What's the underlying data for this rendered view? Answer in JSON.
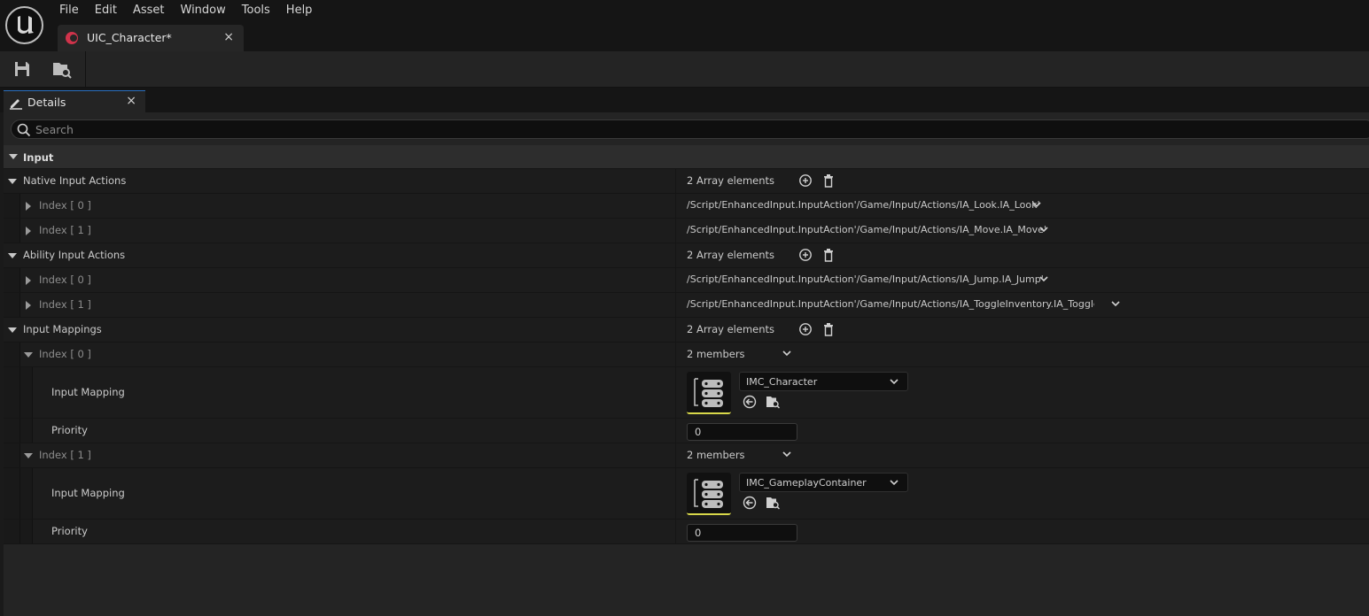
{
  "menu": [
    "File",
    "Edit",
    "Asset",
    "Window",
    "Tools",
    "Help"
  ],
  "document_tab": {
    "label": "UIC_Character*",
    "close": "×"
  },
  "details_tab": {
    "label": "Details",
    "close": "×"
  },
  "search": {
    "placeholder": "Search"
  },
  "category": "Input",
  "native_input_actions": {
    "label": "Native Input Actions",
    "count": "2 Array elements",
    "items": [
      {
        "index": "Index [ 0 ]",
        "value": "/Script/EnhancedInput.InputAction'/Game/Input/Actions/IA_Look.IA_Look'"
      },
      {
        "index": "Index [ 1 ]",
        "value": "/Script/EnhancedInput.InputAction'/Game/Input/Actions/IA_Move.IA_Move'"
      }
    ]
  },
  "ability_input_actions": {
    "label": "Ability Input Actions",
    "count": "2 Array elements",
    "items": [
      {
        "index": "Index [ 0 ]",
        "value": "/Script/EnhancedInput.InputAction'/Game/Input/Actions/IA_Jump.IA_Jump'"
      },
      {
        "index": "Index [ 1 ]",
        "value": "/Script/EnhancedInput.InputAction'/Game/Input/Actions/IA_ToggleInventory.IA_ToggleInver"
      }
    ]
  },
  "input_mappings": {
    "label": "Input Mappings",
    "count": "2 Array elements",
    "items": [
      {
        "index": "Index [ 0 ]",
        "members": "2 members",
        "mapping_label": "Input Mapping",
        "mapping_value": "IMC_Character",
        "priority_label": "Priority",
        "priority_value": "0"
      },
      {
        "index": "Index [ 1 ]",
        "members": "2 members",
        "mapping_label": "Input Mapping",
        "mapping_value": "IMC_GameplayContainer",
        "priority_label": "Priority",
        "priority_value": "0"
      }
    ]
  },
  "icons": {
    "logo": "unreal-logo-icon",
    "save": "save-icon",
    "browse": "browse-asset-icon",
    "details": "pencil-icon",
    "add": "add-element-icon",
    "delete": "delete-all-icon",
    "use_selected": "use-selected-icon",
    "browse_to": "browse-to-asset-icon"
  },
  "colors": {
    "accent_tab": "#2b6fbf",
    "asset_dot": "#d0334b",
    "thumb_underline": "#d8d84a"
  }
}
